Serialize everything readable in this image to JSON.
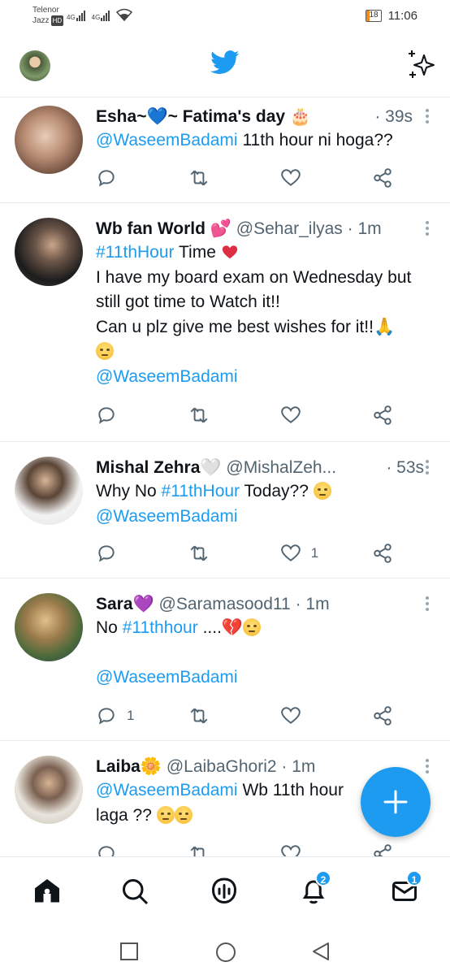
{
  "status_bar": {
    "carrier1": "Telenor",
    "carrier2": "Jazz",
    "hd": "HD",
    "net1": "4G",
    "net2": "4G",
    "battery": "18",
    "time": "11:06"
  },
  "header": {
    "logo": "twitter-bird-icon",
    "sparkle": "sparkle-icon"
  },
  "tweets": [
    {
      "name": "Esha~💙~ Fatima's day 🎂",
      "handle": "",
      "time": "· 39s",
      "mention": "@WaseemBadami",
      "text": "11th hour ni hoga??"
    },
    {
      "name": "Wb fan World 💕",
      "handle": "@Sehar_ilyas",
      "time": "· 1m",
      "hashtag": "#11thHour",
      "line1": "Time",
      "line2": "I have my board exam on Wednesday but",
      "line3": "still got time to Watch it!!",
      "line4": "Can u plz give me best wishes for it!!🙏",
      "mention": "@WaseemBadami"
    },
    {
      "name": "Mishal Zehra🤍",
      "handle": "@MishalZeh...",
      "time": "· 53s",
      "line1_pre": "Why No",
      "hashtag": "#11thHour",
      "line1_post": "Today??",
      "mention": "@WaseemBadami",
      "likes": "1"
    },
    {
      "name": "Sara💜",
      "handle": "@Saramasood11",
      "time": "· 1m",
      "line1_pre": "No",
      "hashtag": "#11thhour",
      "line1_post": "....💔",
      "mention": "@WaseemBadami",
      "replies": "1"
    },
    {
      "name": "Laiba🌼",
      "handle": "@LaibaGhori2",
      "time": "· 1m",
      "mention": "@WaseemBadami",
      "text": "Wb 11th hour",
      "line2": "laga ??"
    }
  ],
  "bottom_nav": {
    "spaces_badge": "",
    "notifications_badge": "2",
    "messages_badge": "1"
  },
  "colors": {
    "accent": "#1d9bf0",
    "text": "#0f1419",
    "muted": "#536471"
  }
}
